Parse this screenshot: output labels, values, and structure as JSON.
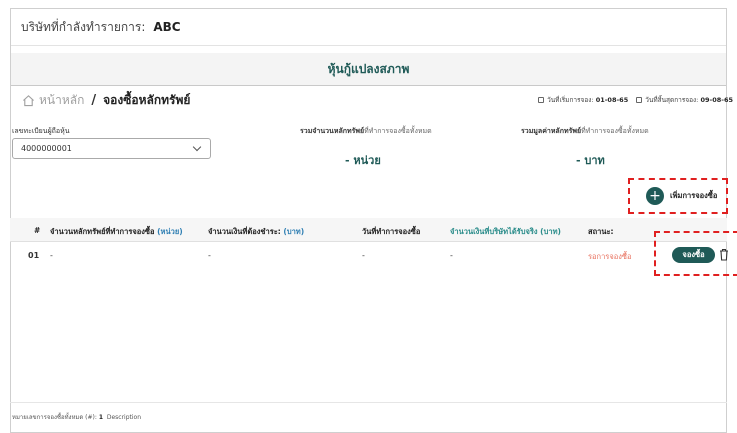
{
  "company": {
    "label": "บริษัทที่กำลังทำรายการ:",
    "name": "ABC"
  },
  "banner": {
    "title": "หุ้นกู้แปลงสภาพ"
  },
  "breadcrumb": {
    "home": "หน้าหลัก",
    "separator": "/",
    "current": "จองซื้อหลักทรัพย์"
  },
  "dates": {
    "start_label": "วันที่เริ่มการจอง:",
    "start_value": "01-08-65",
    "end_label": "วันที่สิ้นสุดการจอง:",
    "end_value": "09-08-65"
  },
  "shareholder": {
    "label": "เลขทะเบียนผู้ถือหุ้น",
    "selected": "4000000001"
  },
  "summary": {
    "units_label_bold": "รวมจำนวนหลักทรัพย์",
    "units_label_light": "ที่ทำการจองซื้อทั้งหมด",
    "units_value": "- หน่วย",
    "value_label_bold": "รวมมูลค่าหลักทรัพย์",
    "value_label_light": "ที่ทำการจองซื้อทั้งหมด",
    "value_value": "- บาท"
  },
  "add_button": {
    "icon": "+",
    "label": "เพิ่มการจองซื้อ"
  },
  "table": {
    "headers": {
      "index": "#",
      "units": "จำนวนหลักทรัพย์ที่ทำการจองซื้อ",
      "units_unit": "(หน่วย)",
      "amount": "จำนวนเงินที่ต้องชำระ:",
      "amount_unit": "(บาท)",
      "date": "วันที่ทำการจองซื้อ",
      "received": "จำนวนเงินที่บริษัทได้รับจริง (บาท)",
      "status": "สถานะ:"
    },
    "rows": [
      {
        "index": "01",
        "units": "-",
        "amount": "-",
        "date": "-",
        "received": "-",
        "status": "รอการจองซื้อ",
        "action": "จองซื้อ"
      }
    ]
  },
  "footer": {
    "label": "หมายเลขการจองซื้อทั้งหมด (#):",
    "count": "1",
    "description": "Description"
  },
  "colors": {
    "primary": "#1f5a57",
    "highlight": "#e02020",
    "status": "#e86f5c",
    "link": "#2f7fb3"
  }
}
